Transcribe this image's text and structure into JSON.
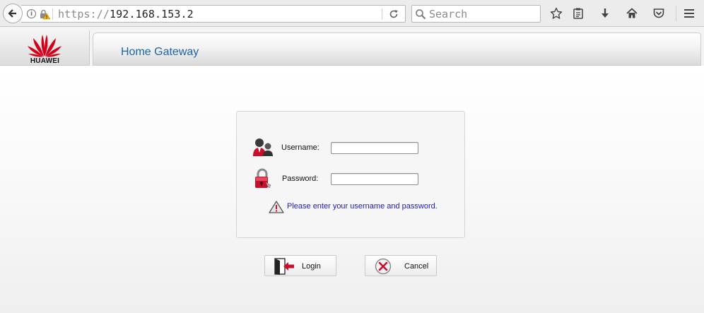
{
  "browser": {
    "url_scheme": "https://",
    "url_host": "192.168.153.2",
    "search_placeholder": "Search"
  },
  "header": {
    "brand": "HUAWEI",
    "title": "Home Gateway"
  },
  "login": {
    "username_label": "Username:",
    "username_value": "",
    "password_label": "Password:",
    "password_value": "",
    "hint": "Please enter your username and password.",
    "login_label": "Login",
    "cancel_label": "Cancel"
  },
  "colors": {
    "title_blue": "#1a64a8",
    "hint_blue": "#1a1ac8",
    "brand_red": "#d4001a"
  },
  "icons": [
    "back-arrow-icon",
    "info-icon",
    "warning-lock-icon",
    "reload-icon",
    "search-icon",
    "bookmark-star-icon",
    "reading-list-icon",
    "download-icon",
    "home-icon",
    "pocket-icon",
    "menu-icon",
    "huawei-logo",
    "user-icon",
    "password-lock-icon",
    "warning-icon",
    "login-door-icon",
    "cancel-x-icon"
  ]
}
